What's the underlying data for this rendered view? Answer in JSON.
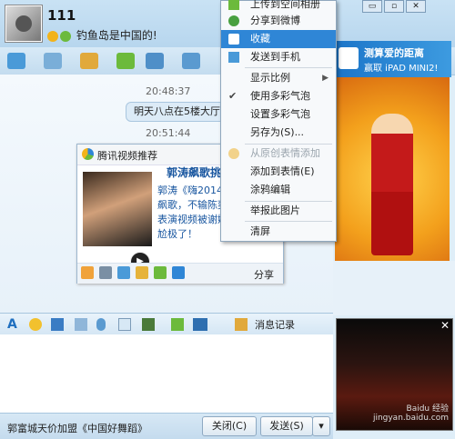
{
  "window": {
    "close_glyph": "✕",
    "maximize_glyph": "▫",
    "minimize_glyph": "▭"
  },
  "header": {
    "name": "111",
    "signature": "钓鱼岛是中国的!"
  },
  "chat": {
    "time1": "20:48:37",
    "message1": "明天八点在5楼大厅",
    "time2": "20:51:44",
    "card": {
      "title": "腾讯视频推荐",
      "headline": "郭涛飙歌挑战",
      "lines": [
        "郭涛《嗨2014》",
        "飙歌，不输陈奕",
        "表演视频被谢娜",
        "尬极了！"
      ],
      "share": "分享"
    }
  },
  "ad": {
    "line1": "测算爱的距离",
    "line2": "赢取 iPAD MINI2!"
  },
  "context_menu": {
    "items": [
      {
        "label": "上传到空间相册",
        "state": "normal",
        "icon": "upload-album-icon"
      },
      {
        "label": "分享到微博",
        "state": "normal",
        "icon": "weibo-icon"
      },
      {
        "label": "收藏",
        "state": "selected",
        "icon": "star-icon"
      },
      {
        "label": "发送到手机",
        "state": "normal",
        "icon": "phone-icon"
      },
      {
        "label": "显示比例",
        "state": "normal",
        "icon": "none",
        "submenu": true
      },
      {
        "label": "使用多彩气泡",
        "state": "checked",
        "icon": "check-icon"
      },
      {
        "label": "设置多彩气泡",
        "state": "normal",
        "icon": "none"
      },
      {
        "label": "另存为(S)...",
        "state": "normal",
        "icon": "none"
      },
      {
        "label": "从原创表情添加",
        "state": "disabled",
        "icon": "emoji-icon"
      },
      {
        "label": "添加到表情(E)",
        "state": "normal",
        "icon": "none"
      },
      {
        "label": "涂鸦编辑",
        "state": "normal",
        "icon": "none"
      },
      {
        "label": "举报此图片",
        "state": "normal",
        "icon": "none"
      },
      {
        "label": "清屏",
        "state": "normal",
        "icon": "none"
      }
    ]
  },
  "input_toolbar": {
    "message_record": "消息记录"
  },
  "bottom": {
    "ticker": "郭富城天价加盟《中国好舞蹈》",
    "close_button": "关闭(C)",
    "send_button": "发送(S)"
  },
  "watermark": "Baidu 经验 jingyan.baidu.com",
  "colors": {
    "accent": "#2f86d6",
    "link": "#1a57a0"
  }
}
